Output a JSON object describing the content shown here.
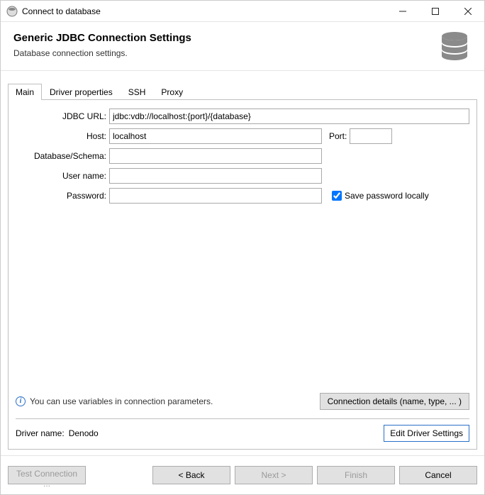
{
  "window": {
    "title": "Connect to database"
  },
  "header": {
    "title": "Generic JDBC Connection Settings",
    "subtitle": "Database connection settings."
  },
  "tabs": {
    "main": "Main",
    "driver_props": "Driver properties",
    "ssh": "SSH",
    "proxy": "Proxy"
  },
  "form": {
    "jdbc_label": "JDBC URL:",
    "jdbc_value": "jdbc:vdb://localhost:{port}/{database}",
    "host_label": "Host:",
    "host_value": "localhost",
    "port_label": "Port:",
    "port_value": "",
    "db_label": "Database/Schema:",
    "db_value": "",
    "user_label": "User name:",
    "user_value": "",
    "pw_label": "Password:",
    "pw_value": "",
    "save_pw_label": "Save password locally",
    "save_pw_checked": true
  },
  "info": {
    "text": "You can use variables in connection parameters.",
    "conn_details_btn": "Connection details (name, type, ... )"
  },
  "driver": {
    "label": "Driver name:",
    "name": "Denodo",
    "edit_btn": "Edit Driver Settings"
  },
  "footer": {
    "test": "Test Connection ...",
    "back": "< Back",
    "next": "Next >",
    "finish": "Finish",
    "cancel": "Cancel"
  }
}
